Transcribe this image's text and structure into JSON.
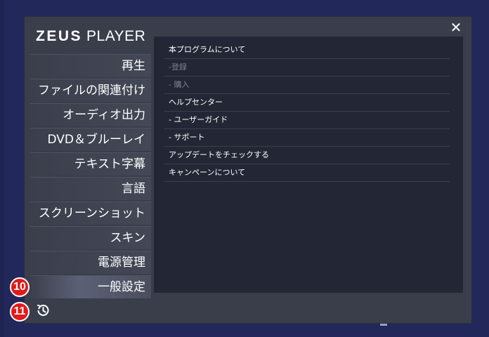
{
  "window": {
    "close_symbol": "✕",
    "logo_word1": "ZEUS",
    "logo_word2": "PLAYER"
  },
  "sidebar": {
    "items": [
      {
        "label": "再生"
      },
      {
        "label": "ファイルの関連付け"
      },
      {
        "label": "オーディオ出力"
      },
      {
        "label": "DVD＆ブルーレイ"
      },
      {
        "label": "テキスト字幕"
      },
      {
        "label": "言語"
      },
      {
        "label": "スクリーンショット"
      },
      {
        "label": "スキン"
      },
      {
        "label": "電源管理"
      },
      {
        "label": "一般設定",
        "active": true
      }
    ]
  },
  "content": {
    "items": [
      {
        "label": "本プログラムについて",
        "enabled": true
      },
      {
        "label": "-登録",
        "enabled": false
      },
      {
        "label": "- 購入",
        "enabled": false
      },
      {
        "label": "ヘルプセンター",
        "enabled": true
      },
      {
        "label": "- ユーザーガイド",
        "enabled": true
      },
      {
        "label": "- サポート",
        "enabled": true
      },
      {
        "label": "アップデートをチェックする",
        "enabled": true
      },
      {
        "label": "キャンペーンについて",
        "enabled": true
      }
    ]
  },
  "annotations": {
    "badge_10": "10",
    "badge_11": "11"
  },
  "icons": {
    "close": "close-icon",
    "history": "history-icon"
  },
  "colors": {
    "desktop": "#22285a",
    "dialog": "#3a3e4b",
    "panel": "#232735",
    "badge": "#e11a1a"
  }
}
